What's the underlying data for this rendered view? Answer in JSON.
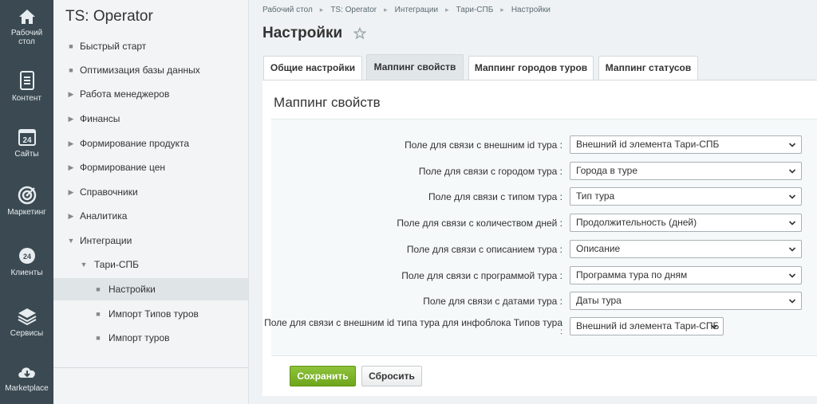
{
  "rail": [
    {
      "label": "Рабочий стол",
      "icon": "home-icon"
    },
    {
      "label": "Контент",
      "icon": "document-icon"
    },
    {
      "label": "Сайты",
      "icon": "calendar-24-icon"
    },
    {
      "label": "Маркетинг",
      "icon": "target-icon"
    },
    {
      "label": "Клиенты",
      "icon": "clients-24-icon"
    },
    {
      "label": "Сервисы",
      "icon": "layers-icon"
    },
    {
      "label": "Marketplace",
      "icon": "cloud-download-icon"
    }
  ],
  "sidebar": {
    "title": "TS: Operator",
    "items": [
      {
        "label": "Быстрый старт",
        "marker": "bullet"
      },
      {
        "label": "Оптимизация базы данных",
        "marker": "bullet"
      },
      {
        "label": "Работа менеджеров",
        "marker": "arrow-right"
      },
      {
        "label": "Финансы",
        "marker": "arrow-right"
      },
      {
        "label": "Формирование продукта",
        "marker": "arrow-right"
      },
      {
        "label": "Формирование цен",
        "marker": "arrow-right"
      },
      {
        "label": "Справочники",
        "marker": "arrow-right"
      },
      {
        "label": "Аналитика",
        "marker": "arrow-right"
      },
      {
        "label": "Интеграции",
        "marker": "arrow-down"
      },
      {
        "label": "Тари-СПБ",
        "marker": "arrow-down"
      },
      {
        "label": "Настройки",
        "marker": "bullet",
        "active": true
      },
      {
        "label": "Импорт Типов туров",
        "marker": "bullet"
      },
      {
        "label": "Импорт туров",
        "marker": "bullet"
      }
    ]
  },
  "breadcrumb": [
    "Рабочий стол",
    "TS: Operator",
    "Интеграции",
    "Тари-СПБ",
    "Настройки"
  ],
  "page": {
    "title": "Настройки"
  },
  "tabs": [
    {
      "label": "Общие настройки"
    },
    {
      "label": "Маппинг свойств",
      "active": true
    },
    {
      "label": "Маппинг городов туров"
    },
    {
      "label": "Маппинг статусов"
    }
  ],
  "panel": {
    "title": "Маппинг свойств",
    "fields": [
      {
        "label": "Поле для связи с внешним id тура :",
        "value": "Внешний id элемента Тари-СПБ"
      },
      {
        "label": "Поле для связи с городом тура :",
        "value": "Города в туре"
      },
      {
        "label": "Поле для связи с типом тура :",
        "value": "Тип тура"
      },
      {
        "label": "Поле для связи с количеством дней :",
        "value": "Продолжительность (дней)"
      },
      {
        "label": "Поле для связи с описанием тура :",
        "value": "Описание"
      },
      {
        "label": "Поле для связи с программой тура :",
        "value": "Программа тура по дням"
      },
      {
        "label": "Поле для связи с датами тура :",
        "value": "Даты тура"
      },
      {
        "label": "Поле для связи с внешним id типа тура для инфоблока Типов тура",
        "label_suffix": ":",
        "value": "Внешний id элемента Тари-СПБ"
      }
    ]
  },
  "buttons": {
    "save": "Сохранить",
    "reset": "Сбросить"
  },
  "colors": {
    "rail_bg": "#3b4a52",
    "save_green": "#7ab32a",
    "star": "#9aa6ac"
  }
}
